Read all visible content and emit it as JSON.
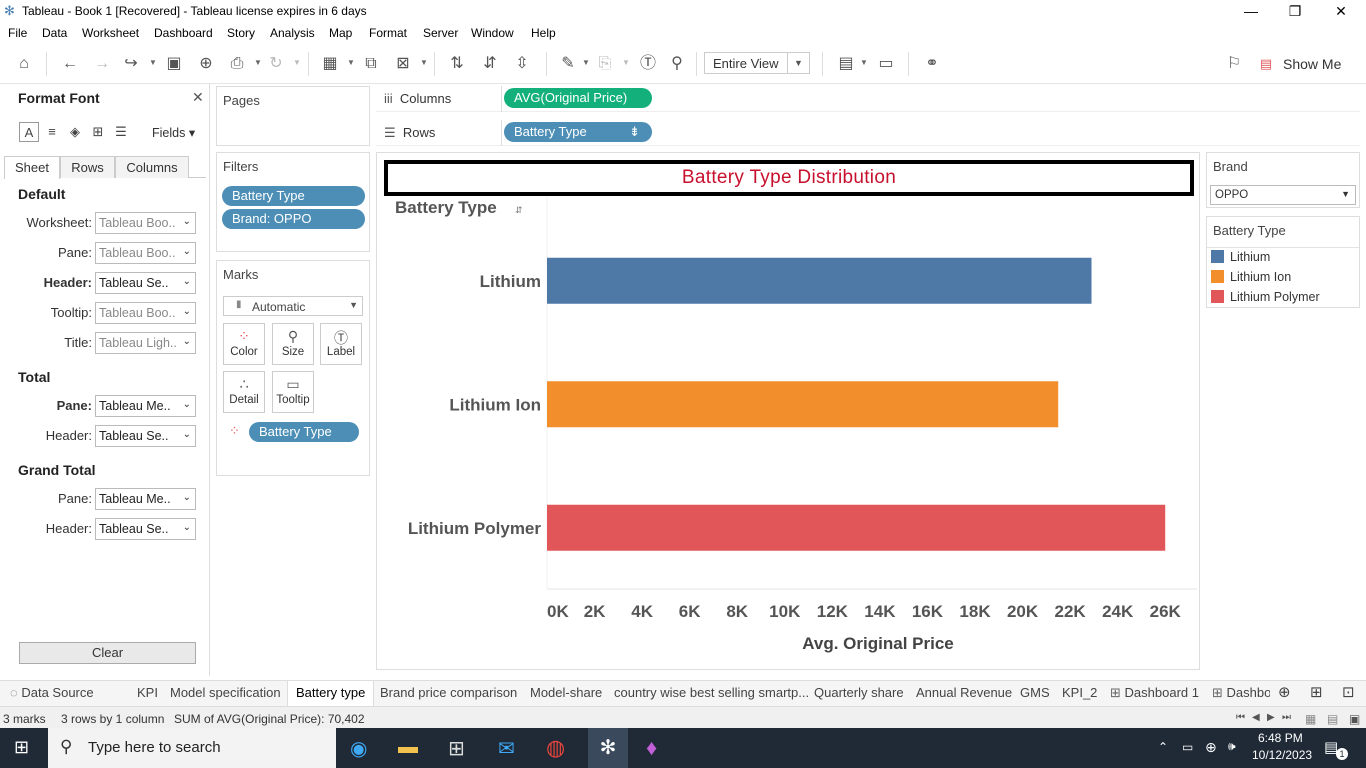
{
  "window": {
    "title": "Tableau - Book 1 [Recovered] - Tableau license expires in 6 days"
  },
  "menu": [
    "File",
    "Data",
    "Worksheet",
    "Dashboard",
    "Story",
    "Analysis",
    "Map",
    "Format",
    "Server",
    "Window",
    "Help"
  ],
  "toolbar": {
    "view_mode": "Entire View",
    "show_me": "Show Me"
  },
  "format_panel": {
    "title": "Format Font",
    "fields_label": "Fields",
    "tabs": [
      "Sheet",
      "Rows",
      "Columns"
    ],
    "sections": {
      "default": "Default",
      "total": "Total",
      "grand_total": "Grand Total"
    },
    "default_rows": [
      {
        "label": "Worksheet:",
        "value": "Tableau Boo.."
      },
      {
        "label": "Pane:",
        "value": "Tableau Boo.."
      },
      {
        "label": "Header:",
        "value": "Tableau Se.."
      },
      {
        "label": "Tooltip:",
        "value": "Tableau Boo.."
      },
      {
        "label": "Title:",
        "value": "Tableau Ligh.."
      }
    ],
    "total_rows": [
      {
        "label": "Pane:",
        "value": "Tableau Me.."
      },
      {
        "label": "Header:",
        "value": "Tableau Se.."
      }
    ],
    "grand_total_rows": [
      {
        "label": "Pane:",
        "value": "Tableau Me.."
      },
      {
        "label": "Header:",
        "value": "Tableau Se.."
      }
    ],
    "clear_label": "Clear"
  },
  "pages": {
    "title": "Pages"
  },
  "filters": {
    "title": "Filters",
    "items": [
      "Battery Type",
      "Brand: OPPO"
    ]
  },
  "marks": {
    "title": "Marks",
    "type": "Automatic",
    "buttons": [
      "Color",
      "Size",
      "Label",
      "Detail",
      "Tooltip"
    ],
    "color_field": "Battery Type"
  },
  "shelves": {
    "columns_label": "Columns",
    "columns_pill": "AVG(Original Price)",
    "rows_label": "Rows",
    "rows_pill": "Battery Type"
  },
  "view": {
    "title": "Battery Type Distribution"
  },
  "chart_data": {
    "type": "bar",
    "orientation": "horizontal",
    "row_header": "Battery Type",
    "categories": [
      "Lithium",
      "Lithium Ion",
      "Lithium Polymer"
    ],
    "values": [
      22900,
      21500,
      26000
    ],
    "colors": [
      "#4e79a7",
      "#f28e2b",
      "#e15759"
    ],
    "xlabel": "Avg. Original Price",
    "xticks": [
      "0K",
      "2K",
      "4K",
      "6K",
      "8K",
      "10K",
      "12K",
      "14K",
      "16K",
      "18K",
      "20K",
      "22K",
      "24K",
      "26K"
    ],
    "xlim": [
      0,
      27000
    ]
  },
  "brand_filter": {
    "title": "Brand",
    "value": "OPPO"
  },
  "legend": {
    "title": "Battery Type",
    "items": [
      {
        "label": "Lithium",
        "color": "#4e79a7"
      },
      {
        "label": "Lithium Ion",
        "color": "#f28e2b"
      },
      {
        "label": "Lithium Polymer",
        "color": "#e15759"
      }
    ]
  },
  "sheet_tabs": [
    "Data Source",
    "KPI",
    "Model specification",
    "Battery type",
    "Brand price comparison",
    "Model-share",
    "country wise best selling smartp...",
    "Quarterly share",
    "Annual Revenue",
    "GMS",
    "KPI_2",
    "Dashboard 1",
    "Dashbo"
  ],
  "active_tab": "Battery type",
  "status": {
    "marks": "3 marks",
    "dims": "3 rows by 1 column",
    "sum": "SUM of AVG(Original Price): 70,402"
  },
  "taskbar": {
    "search_placeholder": "Type here to search",
    "time": "6:48 PM",
    "date": "10/12/2023",
    "notifications": "1"
  }
}
